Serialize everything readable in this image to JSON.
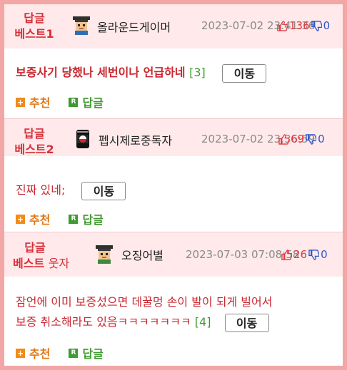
{
  "entries": [
    {
      "badge_top": "답글",
      "badge_bottom": "베스트1",
      "badge_suffix": "",
      "avatar_icon": "pixel-graduate-avatar-icon",
      "nickname": "올라운드게이머",
      "date": "2023-07-02 23:41:36",
      "up_count": "136",
      "down_count": "0",
      "text": "보증사기 당했나 세번이나 언급하네",
      "reply_count": "[3]",
      "go_label": "이동",
      "recommend_label": "추천",
      "reply_label": "답글"
    },
    {
      "badge_top": "답글",
      "badge_bottom": "베스트2",
      "badge_suffix": "",
      "avatar_icon": "soda-can-avatar-icon",
      "nickname": "펩시제로중독자",
      "date": "2023-07-02 23:36:59",
      "up_count": "69",
      "down_count": "0",
      "text": "진짜 있네;",
      "reply_count": "",
      "go_label": "이동",
      "recommend_label": "추천",
      "reply_label": "답글"
    },
    {
      "badge_top": "답글",
      "badge_bottom": "베스트",
      "badge_suffix": "웃자",
      "avatar_icon": "pixel-graduate-avatar-icon",
      "nickname": "오징어별",
      "date": "2023-07-03 07:08:58",
      "up_count": "26",
      "down_count": "0",
      "text_line1": "잠언에 이미 보증섰으면 데꿀멍 손이 발이 되게 빌어서",
      "text_line2": "보증 취소해라도 있음ㅋㅋㅋㅋㅋㅋㅋ",
      "reply_count": "[4]",
      "go_label": "이동",
      "recommend_label": "추천",
      "reply_label": "답글"
    }
  ],
  "colors": {
    "frame": "#f3a6a6",
    "header_bg": "#ffe9ea",
    "accent_red": "#d6303a",
    "recommend_orange": "#e0791a",
    "reply_green": "#3f9a2f",
    "down_blue": "#2d55c8"
  }
}
